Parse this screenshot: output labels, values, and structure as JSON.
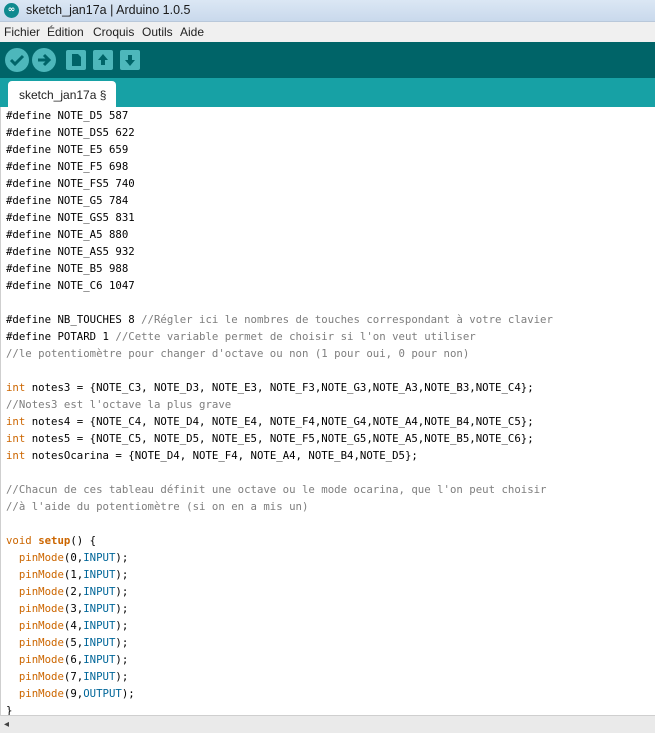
{
  "window": {
    "title": "sketch_jan17a | Arduino 1.0.5",
    "icon": "arduino-icon"
  },
  "menu": [
    "Fichier",
    "Édition",
    "Croquis",
    "Outils",
    "Aide"
  ],
  "toolbar": {
    "buttons": [
      "verify-icon",
      "upload-icon",
      "new-icon",
      "open-icon",
      "save-icon"
    ],
    "colors": {
      "background": "#006468",
      "button": "#4db7bb"
    }
  },
  "tab": {
    "label": "sketch_jan17a §"
  },
  "code_lines": [
    [
      {
        "t": "#define NOTE_D5 587"
      }
    ],
    [
      {
        "t": "#define NOTE_DS5 622"
      }
    ],
    [
      {
        "t": "#define NOTE_E5 659"
      }
    ],
    [
      {
        "t": "#define NOTE_F5 698"
      }
    ],
    [
      {
        "t": "#define NOTE_FS5 740"
      }
    ],
    [
      {
        "t": "#define NOTE_G5 784"
      }
    ],
    [
      {
        "t": "#define NOTE_GS5 831"
      }
    ],
    [
      {
        "t": "#define NOTE_A5 880"
      }
    ],
    [
      {
        "t": "#define NOTE_AS5 932"
      }
    ],
    [
      {
        "t": "#define NOTE_B5 988"
      }
    ],
    [
      {
        "t": "#define NOTE_C6 1047"
      }
    ],
    [],
    [
      {
        "t": "#define NB_TOUCHES 8 "
      },
      {
        "t": "//Régler ici le nombres de touches correspondant à votre clavier",
        "c": "cmt"
      }
    ],
    [
      {
        "t": "#define POTARD 1 "
      },
      {
        "t": "//Cette variable permet de choisir si l'on veut utiliser",
        "c": "cmt"
      }
    ],
    [
      {
        "t": "//le potentiomètre pour changer d'octave ou non (1 pour oui, 0 pour non)",
        "c": "cmt"
      }
    ],
    [],
    [
      {
        "t": "int",
        "c": "kw"
      },
      {
        "t": " notes3 = {NOTE_C3, NOTE_D3, NOTE_E3, NOTE_F3,NOTE_G3,NOTE_A3,NOTE_B3,NOTE_C4};"
      }
    ],
    [
      {
        "t": "//Notes3 est l'octave la plus grave",
        "c": "cmt"
      }
    ],
    [
      {
        "t": "int",
        "c": "kw"
      },
      {
        "t": " notes4 = {NOTE_C4, NOTE_D4, NOTE_E4, NOTE_F4,NOTE_G4,NOTE_A4,NOTE_B4,NOTE_C5};"
      }
    ],
    [
      {
        "t": "int",
        "c": "kw"
      },
      {
        "t": " notes5 = {NOTE_C5, NOTE_D5, NOTE_E5, NOTE_F5,NOTE_G5,NOTE_A5,NOTE_B5,NOTE_C6};"
      }
    ],
    [
      {
        "t": "int",
        "c": "kw"
      },
      {
        "t": " notesOcarina = {NOTE_D4, NOTE_F4, NOTE_A4, NOTE_B4,NOTE_D5};"
      }
    ],
    [],
    [
      {
        "t": "//Chacun de ces tableau définit une octave ou le mode ocarina, que l'on peut choisir",
        "c": "cmt"
      }
    ],
    [
      {
        "t": "//à l'aide du potentiomètre (si on en a mis un)",
        "c": "cmt"
      }
    ],
    [],
    [
      {
        "t": "void",
        "c": "kw"
      },
      {
        "t": " "
      },
      {
        "t": "setup",
        "c": "kwb"
      },
      {
        "t": "() {"
      }
    ],
    [
      {
        "t": "  "
      },
      {
        "t": "pinMode",
        "c": "kw"
      },
      {
        "t": "(0,"
      },
      {
        "t": "INPUT",
        "c": "cst"
      },
      {
        "t": ");"
      }
    ],
    [
      {
        "t": "  "
      },
      {
        "t": "pinMode",
        "c": "kw"
      },
      {
        "t": "(1,"
      },
      {
        "t": "INPUT",
        "c": "cst"
      },
      {
        "t": ");"
      }
    ],
    [
      {
        "t": "  "
      },
      {
        "t": "pinMode",
        "c": "kw"
      },
      {
        "t": "(2,"
      },
      {
        "t": "INPUT",
        "c": "cst"
      },
      {
        "t": ");"
      }
    ],
    [
      {
        "t": "  "
      },
      {
        "t": "pinMode",
        "c": "kw"
      },
      {
        "t": "(3,"
      },
      {
        "t": "INPUT",
        "c": "cst"
      },
      {
        "t": ");"
      }
    ],
    [
      {
        "t": "  "
      },
      {
        "t": "pinMode",
        "c": "kw"
      },
      {
        "t": "(4,"
      },
      {
        "t": "INPUT",
        "c": "cst"
      },
      {
        "t": ");"
      }
    ],
    [
      {
        "t": "  "
      },
      {
        "t": "pinMode",
        "c": "kw"
      },
      {
        "t": "(5,"
      },
      {
        "t": "INPUT",
        "c": "cst"
      },
      {
        "t": ");"
      }
    ],
    [
      {
        "t": "  "
      },
      {
        "t": "pinMode",
        "c": "kw"
      },
      {
        "t": "(6,"
      },
      {
        "t": "INPUT",
        "c": "cst"
      },
      {
        "t": ");"
      }
    ],
    [
      {
        "t": "  "
      },
      {
        "t": "pinMode",
        "c": "kw"
      },
      {
        "t": "(7,"
      },
      {
        "t": "INPUT",
        "c": "cst"
      },
      {
        "t": ");"
      }
    ],
    [
      {
        "t": "  "
      },
      {
        "t": "pinMode",
        "c": "kw"
      },
      {
        "t": "(9,"
      },
      {
        "t": "OUTPUT",
        "c": "cst"
      },
      {
        "t": ");"
      }
    ],
    [
      {
        "t": "}"
      }
    ]
  ]
}
